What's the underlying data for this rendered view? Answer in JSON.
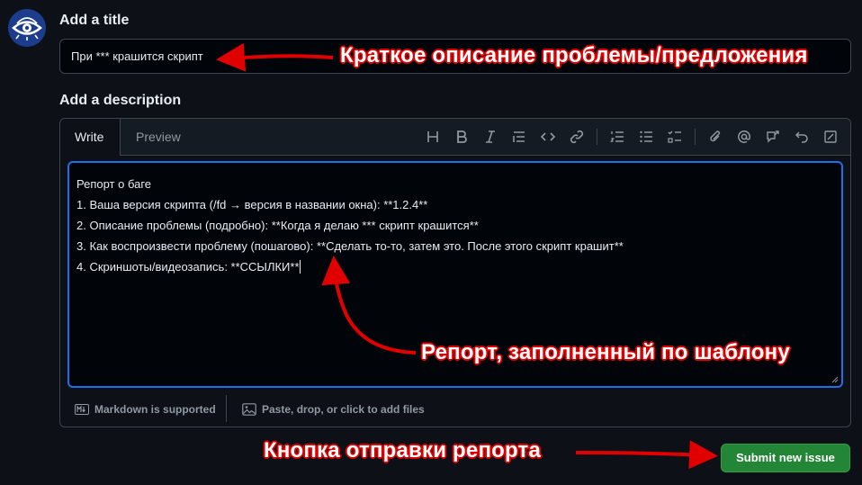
{
  "form": {
    "title_label": "Add a title",
    "title_value": "При *** крашится скрипт",
    "description_label": "Add a description"
  },
  "editor": {
    "tabs": [
      {
        "label": "Write",
        "active": true
      },
      {
        "label": "Preview",
        "active": false
      }
    ],
    "toolbar_icons": [
      "heading-icon",
      "bold-icon",
      "italic-icon",
      "quote-icon",
      "code-icon",
      "link-icon",
      "numbered-list-icon",
      "unordered-list-icon",
      "task-list-icon",
      "attach-icon",
      "mention-icon",
      "reference-icon",
      "undo-icon",
      "fullscreen-icon"
    ],
    "lines": [
      "Репорт о баге",
      "1. Ваша версия скрипта (/fd → версия в названии окна): **1.2.4**",
      "2. Описание проблемы (подробно): **Когда я делаю *** скрипт крашится**",
      "3. Как воспроизвести проблему (пошагово): **Сделать то-то, затем это. После этого скрипт крашит**",
      "4. Скриншоты/видеозапись: **ССЫЛКИ**"
    ],
    "markdown_hint": "Markdown is supported",
    "attach_hint": "Paste, drop, or click to add files"
  },
  "submit_label": "Submit new issue",
  "annotations": {
    "title_note": "Краткое описание проблемы/предложения",
    "report_note": "Репорт, заполненный по шаблону",
    "button_note": "Кнопка отправки репорта"
  },
  "colors": {
    "background": "#0d1117",
    "accent_focus": "#1f6feb",
    "submit_green": "#238636",
    "annotation_red": "#e00000"
  }
}
